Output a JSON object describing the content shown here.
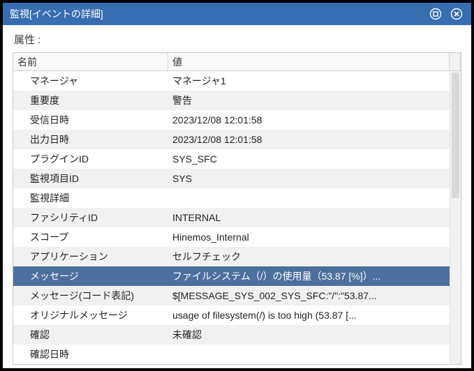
{
  "window": {
    "title": "監視[イベントの詳細]"
  },
  "attr_label": "属性 :",
  "columns": {
    "name": "名前",
    "value": "値"
  },
  "rows": [
    {
      "name": "マネージャ",
      "value": "マネージャ1",
      "selected": false
    },
    {
      "name": "重要度",
      "value": "警告",
      "selected": false
    },
    {
      "name": "受信日時",
      "value": "2023/12/08 12:01:58",
      "selected": false
    },
    {
      "name": "出力日時",
      "value": "2023/12/08 12:01:58",
      "selected": false
    },
    {
      "name": "プラグインID",
      "value": "SYS_SFC",
      "selected": false
    },
    {
      "name": "監視項目ID",
      "value": "SYS",
      "selected": false
    },
    {
      "name": "監視詳細",
      "value": "",
      "selected": false
    },
    {
      "name": "ファシリティID",
      "value": "INTERNAL",
      "selected": false
    },
    {
      "name": "スコープ",
      "value": "Hinemos_Internal",
      "selected": false
    },
    {
      "name": "アプリケーション",
      "value": "セルフチェック",
      "selected": false
    },
    {
      "name": "メッセージ",
      "value": "ファイルシステム（/）の使用量（53.87 [%]）...",
      "selected": true
    },
    {
      "name": "メッセージ(コード表記)",
      "value": "$[MESSAGE_SYS_002_SYS_SFC:\"/\":\"53.87...",
      "selected": false
    },
    {
      "name": "オリジナルメッセージ",
      "value": "usage of filesystem(/) is too high (53.87 [...",
      "selected": false
    },
    {
      "name": "確認",
      "value": "未確認",
      "selected": false
    },
    {
      "name": "確認日時",
      "value": "",
      "selected": false
    }
  ]
}
